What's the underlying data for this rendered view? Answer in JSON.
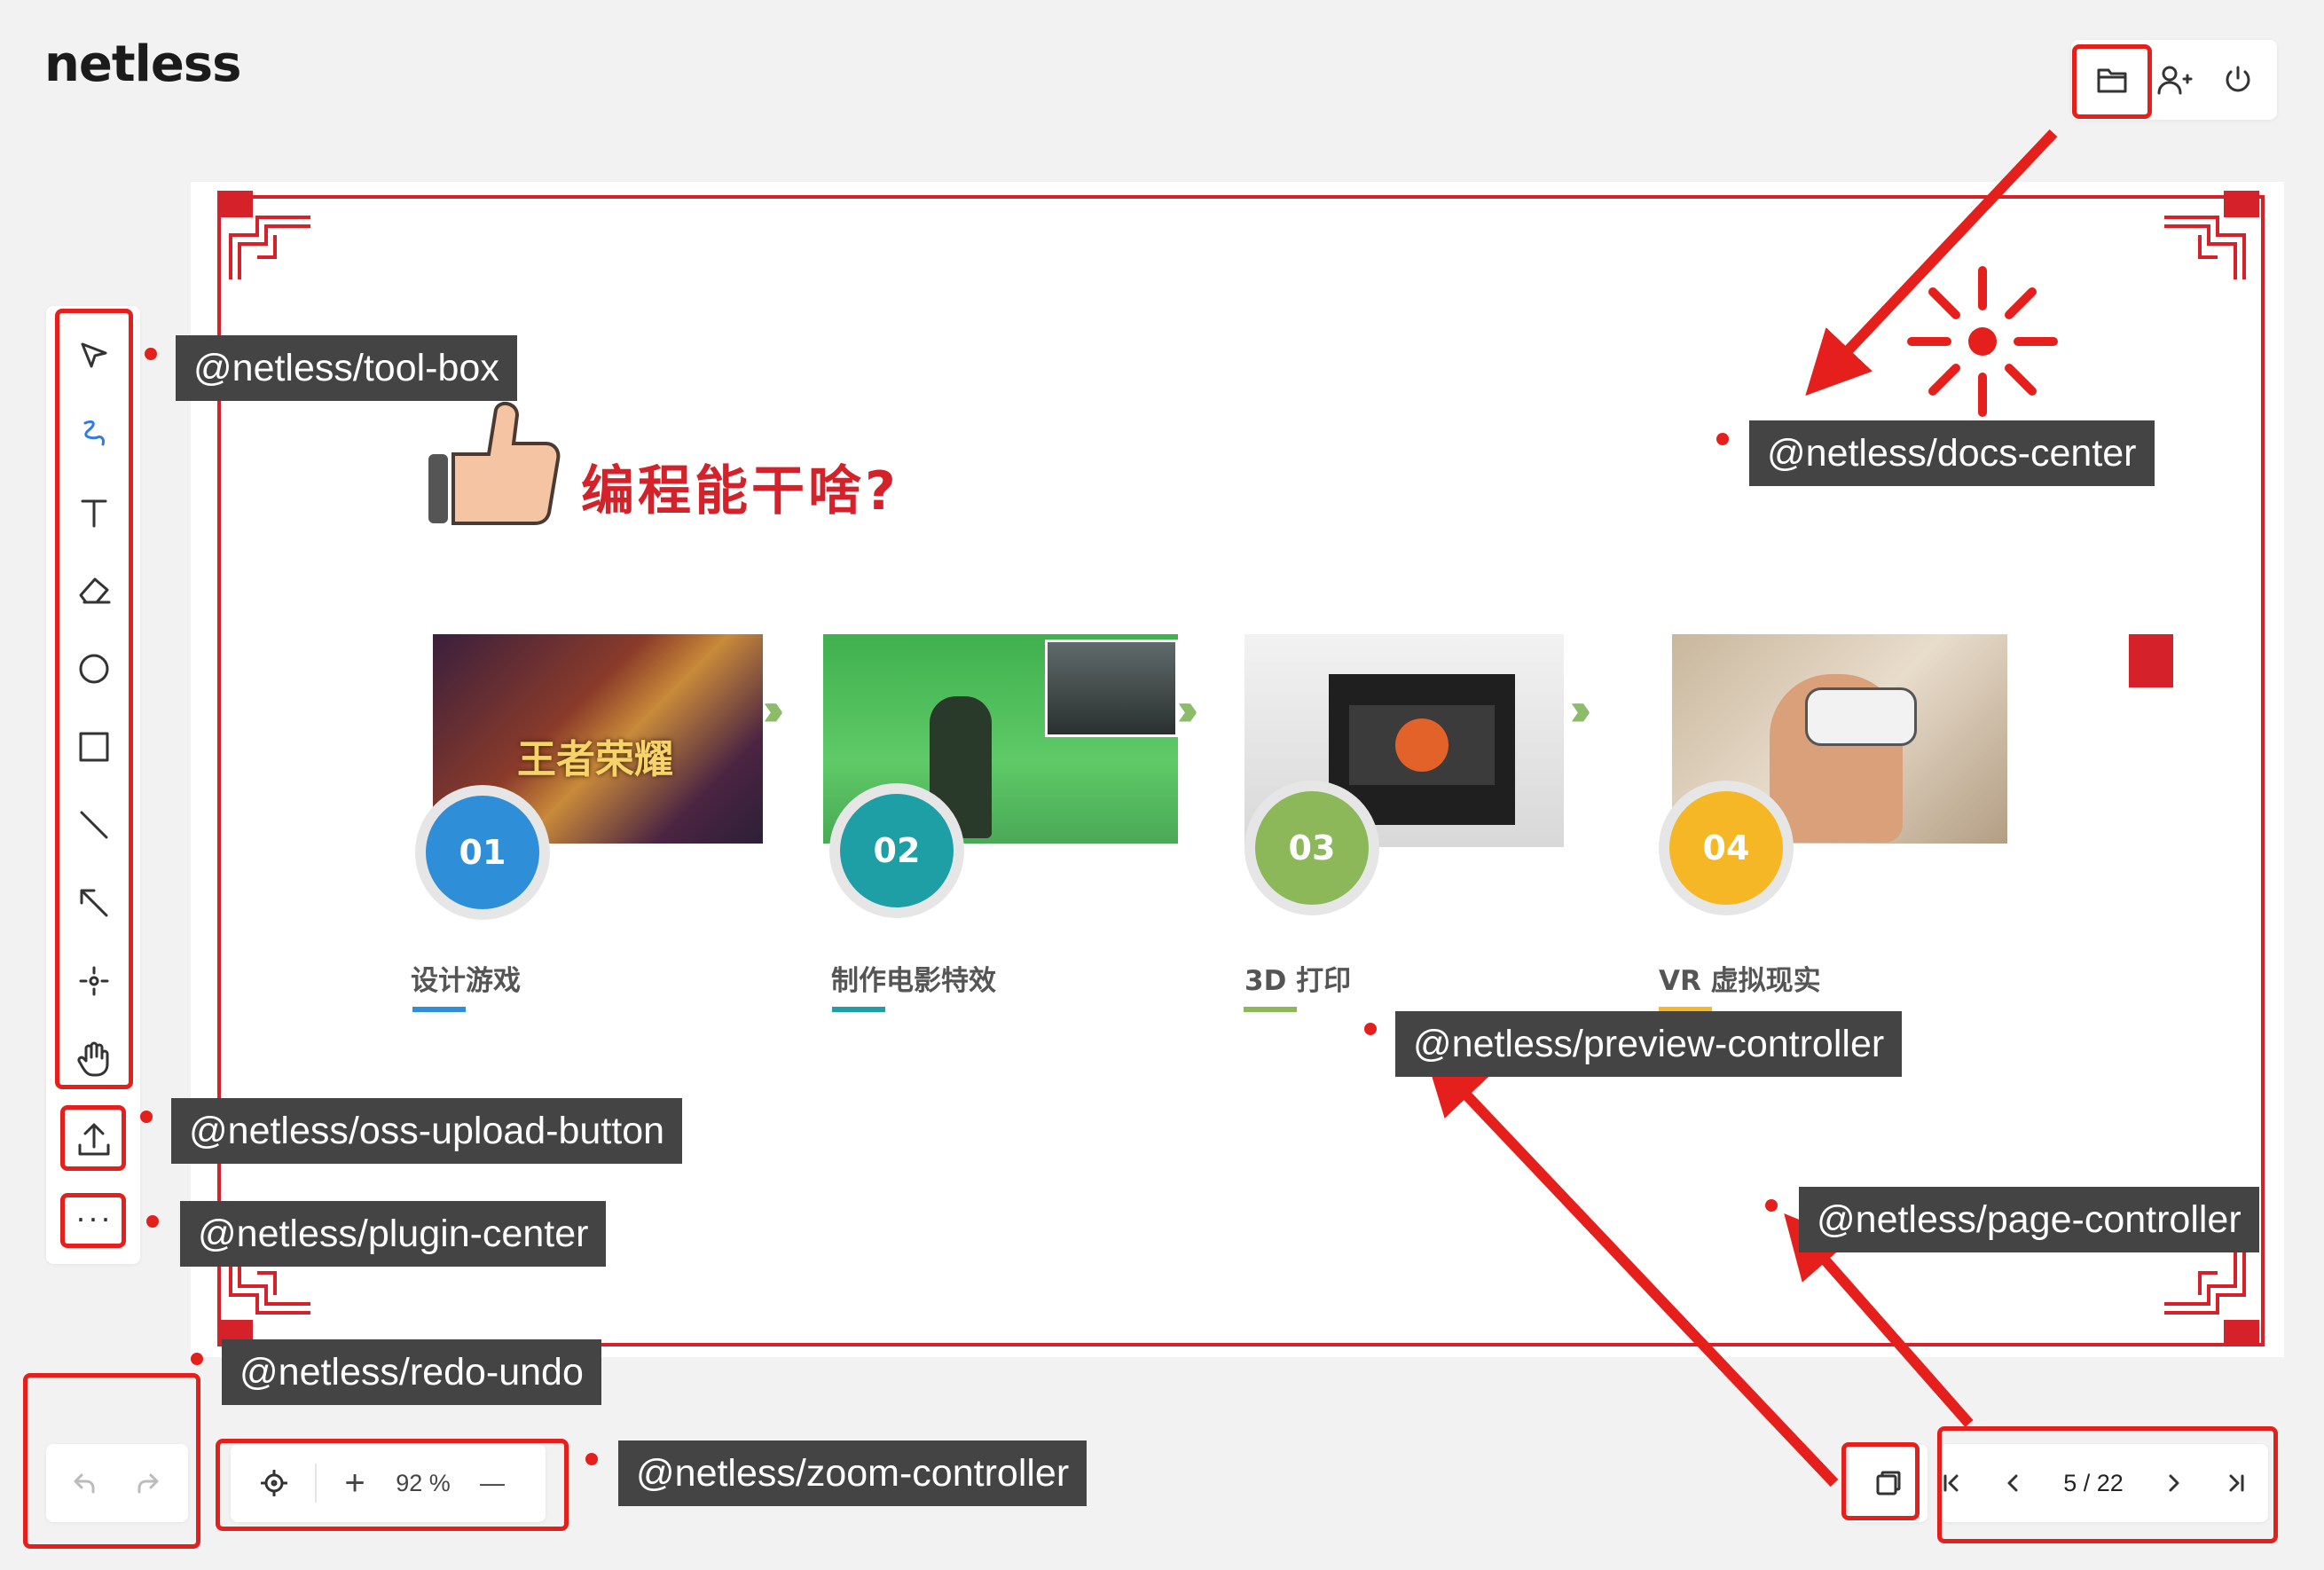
{
  "app": {
    "logo": "netless"
  },
  "top_right": {
    "docs_icon": "folder-icon",
    "invite_icon": "user-plus-icon",
    "exit_icon": "power-icon"
  },
  "toolbox": {
    "tools": [
      "selector-icon",
      "pencil-icon",
      "text-icon",
      "eraser-icon",
      "ellipse-icon",
      "rectangle-icon",
      "straight-line-icon",
      "arrow-icon",
      "laser-pointer-icon",
      "hand-icon"
    ],
    "upload_icon": "upload-icon",
    "more_label": "···"
  },
  "zoom": {
    "value": "92 %",
    "plus": "+",
    "minus": "—"
  },
  "page": {
    "label": "5 / 22"
  },
  "annotations": {
    "tool_box": "@netless/tool-box",
    "docs_center": "@netless/docs-center",
    "preview_controller": "@netless/preview-controller",
    "oss_upload_button": "@netless/oss-upload-button",
    "plugin_center": "@netless/plugin-center",
    "page_controller": "@netless/page-controller",
    "redo_undo": "@netless/redo-undo",
    "zoom_controller": "@netless/zoom-controller"
  },
  "slide": {
    "title": "编程能干啥?",
    "items": [
      {
        "num": "01",
        "caption": "设计游戏",
        "color": "#2e8fd8",
        "overlay": "王者荣耀"
      },
      {
        "num": "02",
        "caption": "制作电影特效",
        "color": "#1e9fa6"
      },
      {
        "num": "03",
        "caption": "3D 打印",
        "color": "#8cb85a"
      },
      {
        "num": "04",
        "caption": "VR 虚拟现实",
        "color": "#f6b726"
      }
    ]
  },
  "colors": {
    "annotation_red": "#e5201c",
    "frame_red": "#d4212a",
    "tag_bg": "#444444"
  }
}
